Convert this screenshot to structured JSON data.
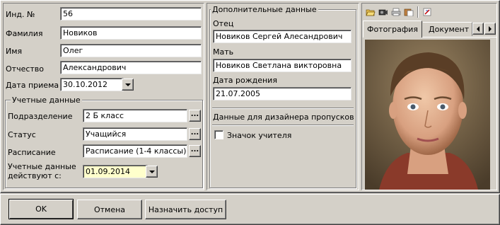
{
  "person": {
    "id_label": "Инд. №",
    "id_value": "56",
    "last_name_label": "Фамилия",
    "last_name_value": "Новиков",
    "first_name_label": "Имя",
    "first_name_value": "Олег",
    "middle_name_label": "Отчество",
    "middle_name_value": "Александрович",
    "hire_date_label": "Дата приема",
    "hire_date_value": "30.10.2012"
  },
  "account": {
    "group_label": "Учетные данные",
    "department_label": "Подразделение",
    "department_value": "2 Б класс",
    "status_label": "Статус",
    "status_value": "Учащийся",
    "schedule_label": "Расписание",
    "schedule_value": "Расписание (1-4 классы)",
    "valid_from_label_1": "Учетные данные",
    "valid_from_label_2": "действуют с:",
    "valid_from_value": "01.09.2014",
    "ellipsis": "..."
  },
  "additional": {
    "group_label": "Дополнительные данные",
    "father_label": "Отец",
    "father_value": "Новиков Сергей Алесандрович",
    "mother_label": "Мать",
    "mother_value": "Новиков Светлана викторовна",
    "birth_label": "Дата рождения",
    "birth_value": "21.07.2005",
    "designer_label": "Данные для дизайнера пропусков",
    "teacher_badge_label": "Значок учителя"
  },
  "photo_panel": {
    "tabs": [
      "Фотография",
      "Документ"
    ],
    "toolbar_icons": [
      "open-folder-icon",
      "camera-icon",
      "print-icon",
      "paste-icon",
      "edit-image-icon"
    ]
  },
  "footer": {
    "ok_label": "OK",
    "cancel_label": "Отмена",
    "assign_access_label": "Назначить доступ"
  },
  "colors": {
    "face": "#d4d0c8",
    "field": "#ffffff",
    "highlight_field": "#ffffcc",
    "photo_background": "#6b5a41"
  }
}
